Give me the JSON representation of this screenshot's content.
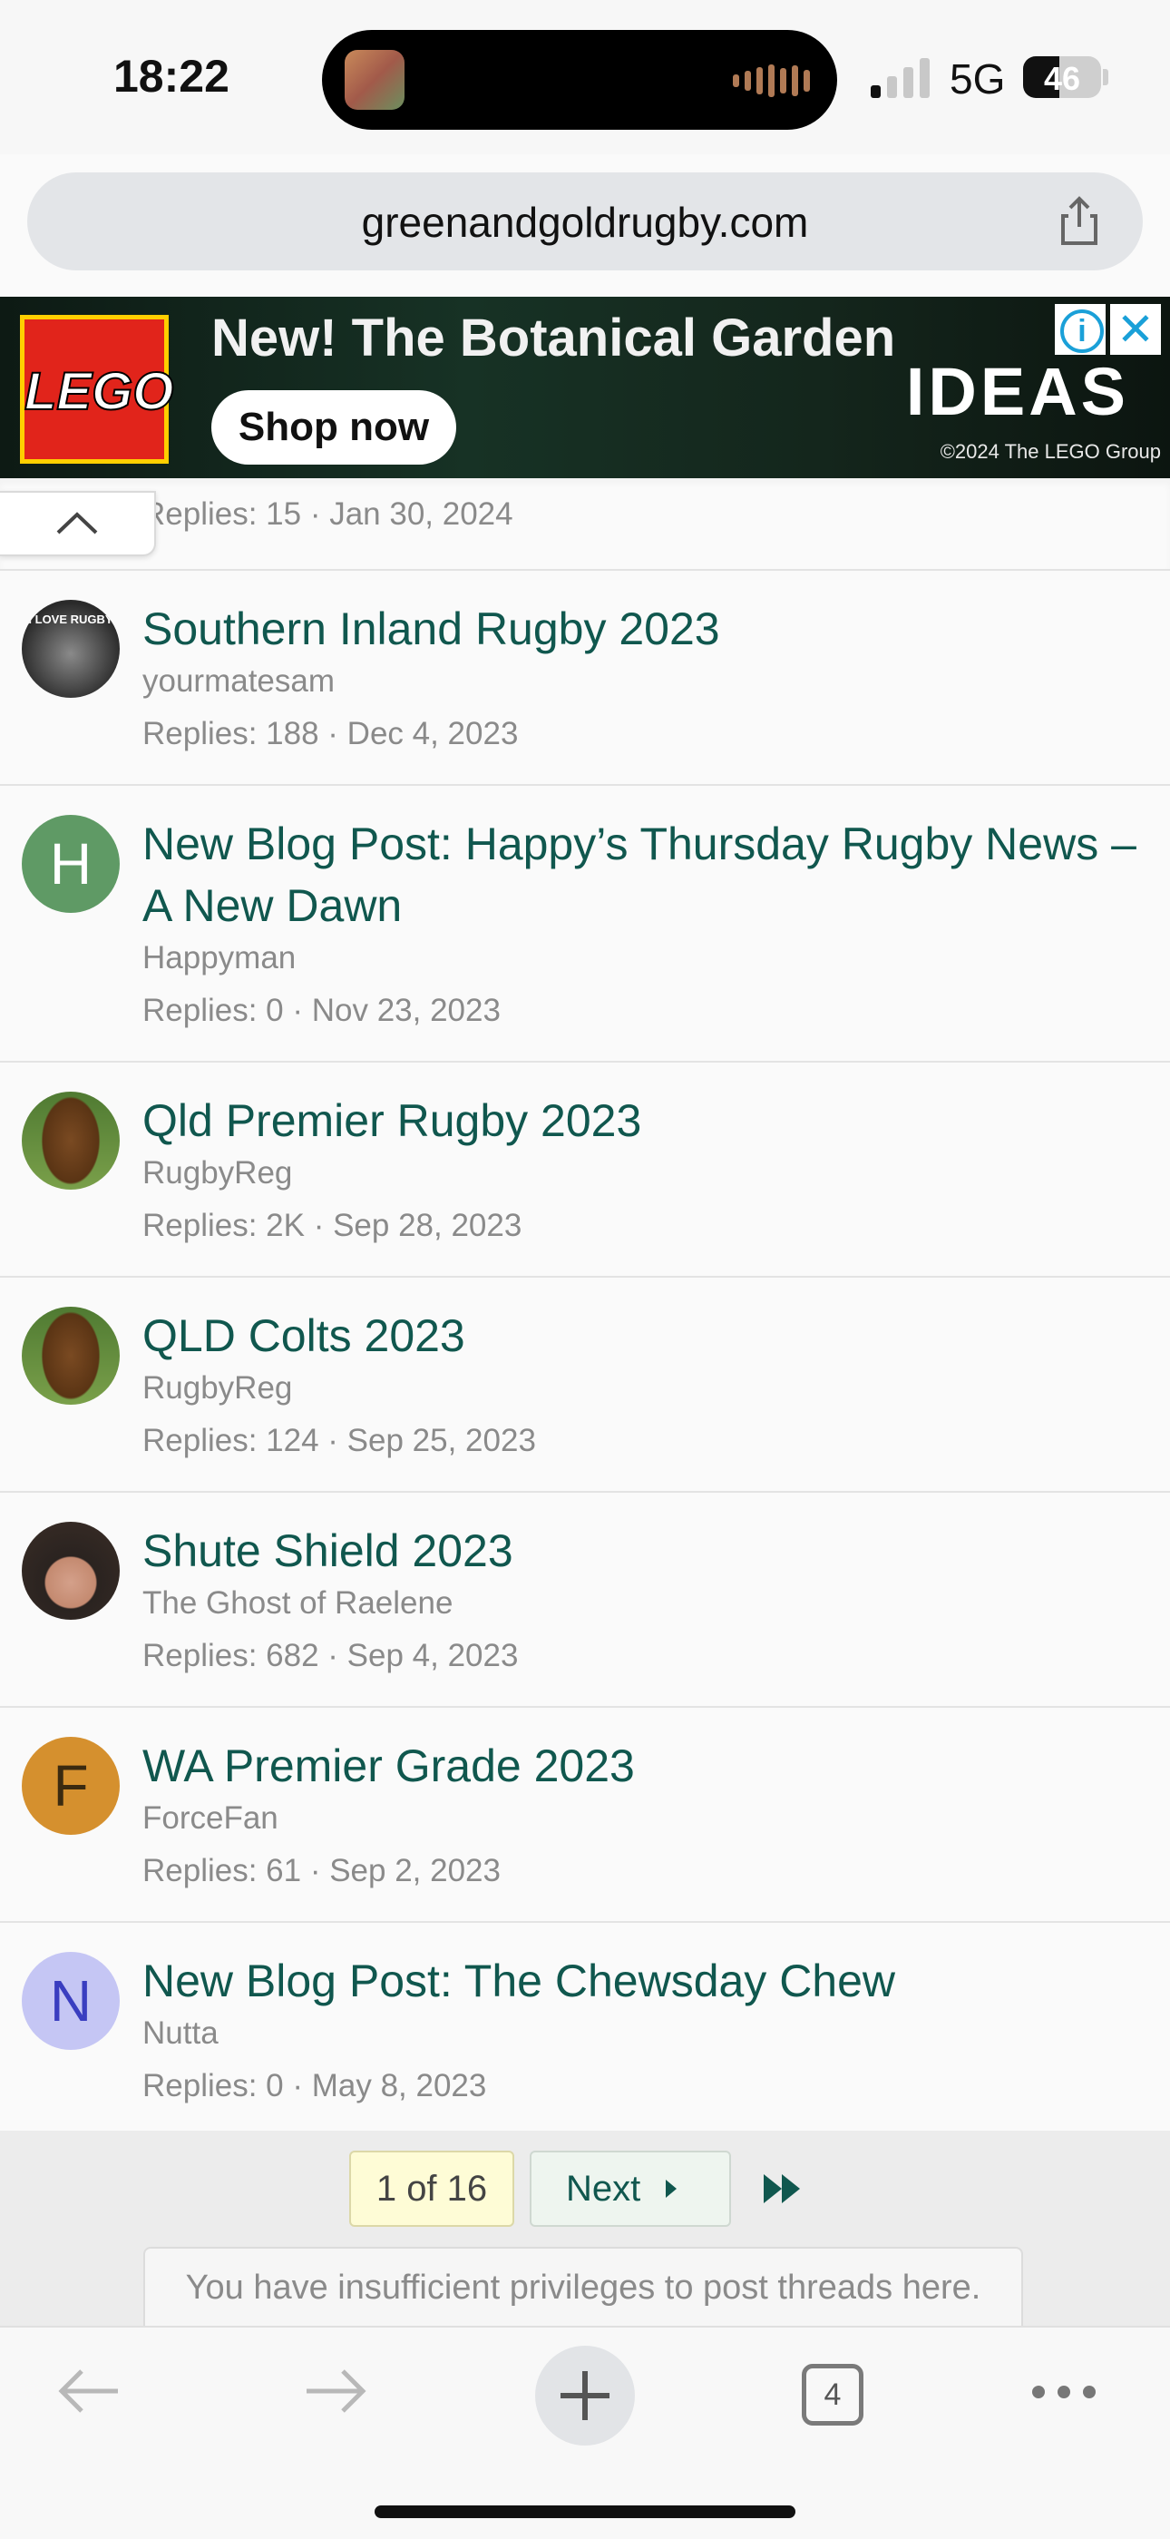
{
  "status_bar": {
    "time": "18:22",
    "network": "5G",
    "battery": "46",
    "battery_level": 0.46
  },
  "browser": {
    "url": "greenandgoldrugby.com",
    "tab_count": "4"
  },
  "ad": {
    "headline": "New! The Botanical Garden",
    "button": "Shop now",
    "brand_logo": "LEGO",
    "brand_right": "IDEAS",
    "copyright": "©2024 The LEGO Group",
    "info_glyph": "i",
    "close_glyph": "✕"
  },
  "threads": {
    "partial_meta": "Replies: 15 · Jan 30, 2024",
    "items": [
      {
        "title": "Southern Inland Rugby 2023",
        "author": "yourmatesam",
        "meta": "Replies: 188 · Dec 4, 2023",
        "avatar": "photo",
        "avatar_text": "I LOVE RUGBY"
      },
      {
        "title": "New Blog Post: Happy’s Thursday Rugby News – A New Dawn",
        "author": "Happyman",
        "meta": "Replies: 0 · Nov 23, 2023",
        "avatar": "letter",
        "letter": "H",
        "color": "#5f9a65"
      },
      {
        "title": "Qld Premier Rugby 2023",
        "author": "RugbyReg",
        "meta": "Replies: 2K · Sep 28, 2023",
        "avatar": "photo"
      },
      {
        "title": "QLD Colts 2023",
        "author": "RugbyReg",
        "meta": "Replies: 124 · Sep 25, 2023",
        "avatar": "photo"
      },
      {
        "title": "Shute Shield 2023",
        "author": "The Ghost of Raelene",
        "meta": "Replies: 682 · Sep 4, 2023",
        "avatar": "photo"
      },
      {
        "title": "WA Premier Grade 2023",
        "author": "ForceFan",
        "meta": "Replies: 61 · Sep 2, 2023",
        "avatar": "letter",
        "letter": "F",
        "color": "#d5902e"
      },
      {
        "title": "New Blog Post: The Chewsday Chew",
        "author": "Nutta",
        "meta": "Replies: 0 · May 8, 2023",
        "avatar": "letter",
        "letter": "N",
        "color": "#c5c6f4",
        "letter_color": "#3a3ec0"
      }
    ]
  },
  "pagination": {
    "current": "1 of 16",
    "next": "Next"
  },
  "notice": "You have insufficient privileges to post threads here.",
  "colors": {
    "link": "#10574e",
    "meta": "#8a8a8a"
  }
}
